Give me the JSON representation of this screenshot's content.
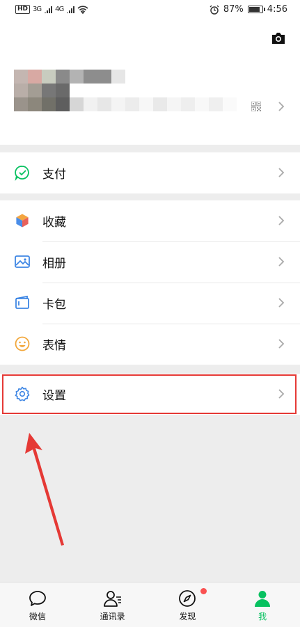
{
  "status_bar": {
    "hd": "HD",
    "net1": "3G",
    "net2": "4G",
    "battery_pct": "87%",
    "battery_level": 0.87,
    "time": "4:56",
    "icons": [
      "alarm-icon",
      "battery-icon",
      "wifi-icon",
      "signal-icon"
    ]
  },
  "profile": {
    "icons": [
      "camera-icon",
      "qr-code-icon",
      "chevron-right-icon"
    ]
  },
  "menu": {
    "pay": {
      "label": "支付",
      "icon": "pay-icon"
    },
    "favorites": {
      "label": "收藏",
      "icon": "cube-icon"
    },
    "album": {
      "label": "相册",
      "icon": "image-icon"
    },
    "cards": {
      "label": "卡包",
      "icon": "wallet-icon"
    },
    "stickers": {
      "label": "表情",
      "icon": "smile-icon"
    },
    "settings": {
      "label": "设置",
      "icon": "gear-icon"
    }
  },
  "tabs": [
    {
      "label": "微信",
      "icon": "chat-bubble-icon"
    },
    {
      "label": "通讯录",
      "icon": "contacts-icon"
    },
    {
      "label": "发现",
      "icon": "compass-icon"
    },
    {
      "label": "我",
      "icon": "person-icon"
    }
  ],
  "colors": {
    "accent": "#07c160",
    "icon_blue": "#3e86e4",
    "highlight_red": "#e53935",
    "badge_red": "#fa5151",
    "background": "#ededed"
  }
}
